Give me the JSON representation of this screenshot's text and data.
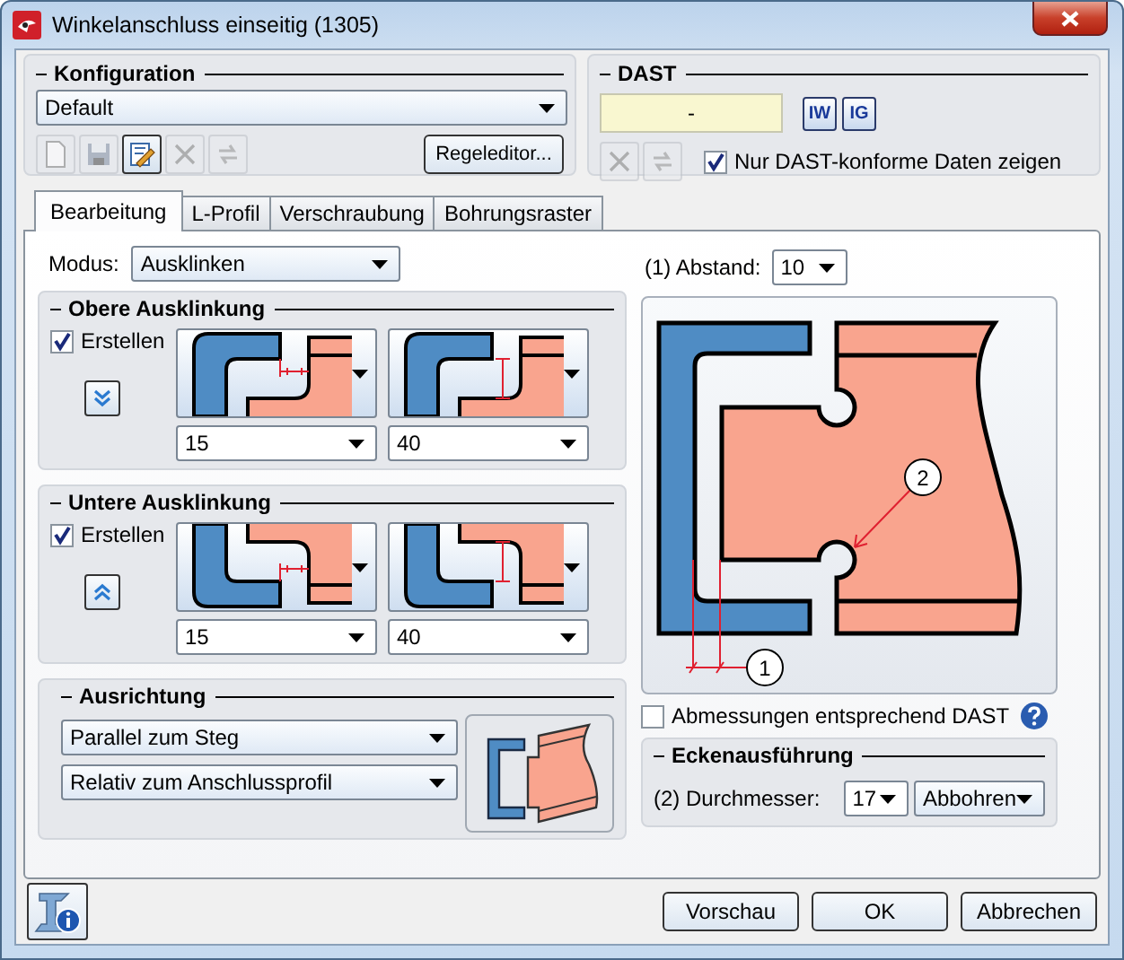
{
  "window": {
    "title": "Winkelanschluss einseitig (1305)"
  },
  "konfiguration": {
    "title": "Konfiguration",
    "dropdown": "Default",
    "toolbar": [
      {
        "kind": "new",
        "disabled": true
      },
      {
        "kind": "save",
        "disabled": true
      },
      {
        "kind": "edit",
        "disabled": false
      },
      {
        "kind": "delete",
        "disabled": true
      },
      {
        "kind": "refresh",
        "disabled": true
      }
    ],
    "rule_editor_button": "Regeleditor..."
  },
  "dast": {
    "title": "DAST",
    "value": "-",
    "buttons": [
      "IW",
      "IG"
    ],
    "toolbar": [
      {
        "kind": "delete",
        "disabled": true
      },
      {
        "kind": "refresh",
        "disabled": true
      }
    ],
    "checkbox": {
      "label": "Nur DAST-konforme Daten zeigen",
      "checked": true
    }
  },
  "tabs": [
    {
      "label": "Bearbeitung",
      "selected": true
    },
    {
      "label": "L-Profil",
      "selected": false
    },
    {
      "label": "Verschraubung",
      "selected": false
    },
    {
      "label": "Bohrungsraster",
      "selected": false
    }
  ],
  "modus": {
    "label": "Modus:",
    "value": "Ausklinken"
  },
  "notches": [
    {
      "title": "Obere Ausklinkung",
      "kind": "upper",
      "create": {
        "label": "Erstellen",
        "checked": true
      },
      "values": [
        "15",
        "40"
      ]
    },
    {
      "title": "Untere Ausklinkung",
      "kind": "lower",
      "create": {
        "label": "Erstellen",
        "checked": true
      },
      "values": [
        "15",
        "40"
      ]
    }
  ],
  "ausrichtung": {
    "title": "Ausrichtung",
    "dropdowns": [
      "Parallel zum Steg",
      "Relativ zum Anschlussprofil"
    ]
  },
  "abstand": {
    "label": "(1) Abstand:",
    "value": "10"
  },
  "diagram": {
    "callouts": [
      "1",
      "2"
    ]
  },
  "dast_dimensions": {
    "label": "Abmessungen entsprechend DAST",
    "checked": false
  },
  "ecken": {
    "title": "Eckenausführung",
    "label": "(2) Durchmesser:",
    "diameter": "17",
    "mode": "Abbohren"
  },
  "buttons": [
    "Vorschau",
    "OK",
    "Abbrechen"
  ]
}
